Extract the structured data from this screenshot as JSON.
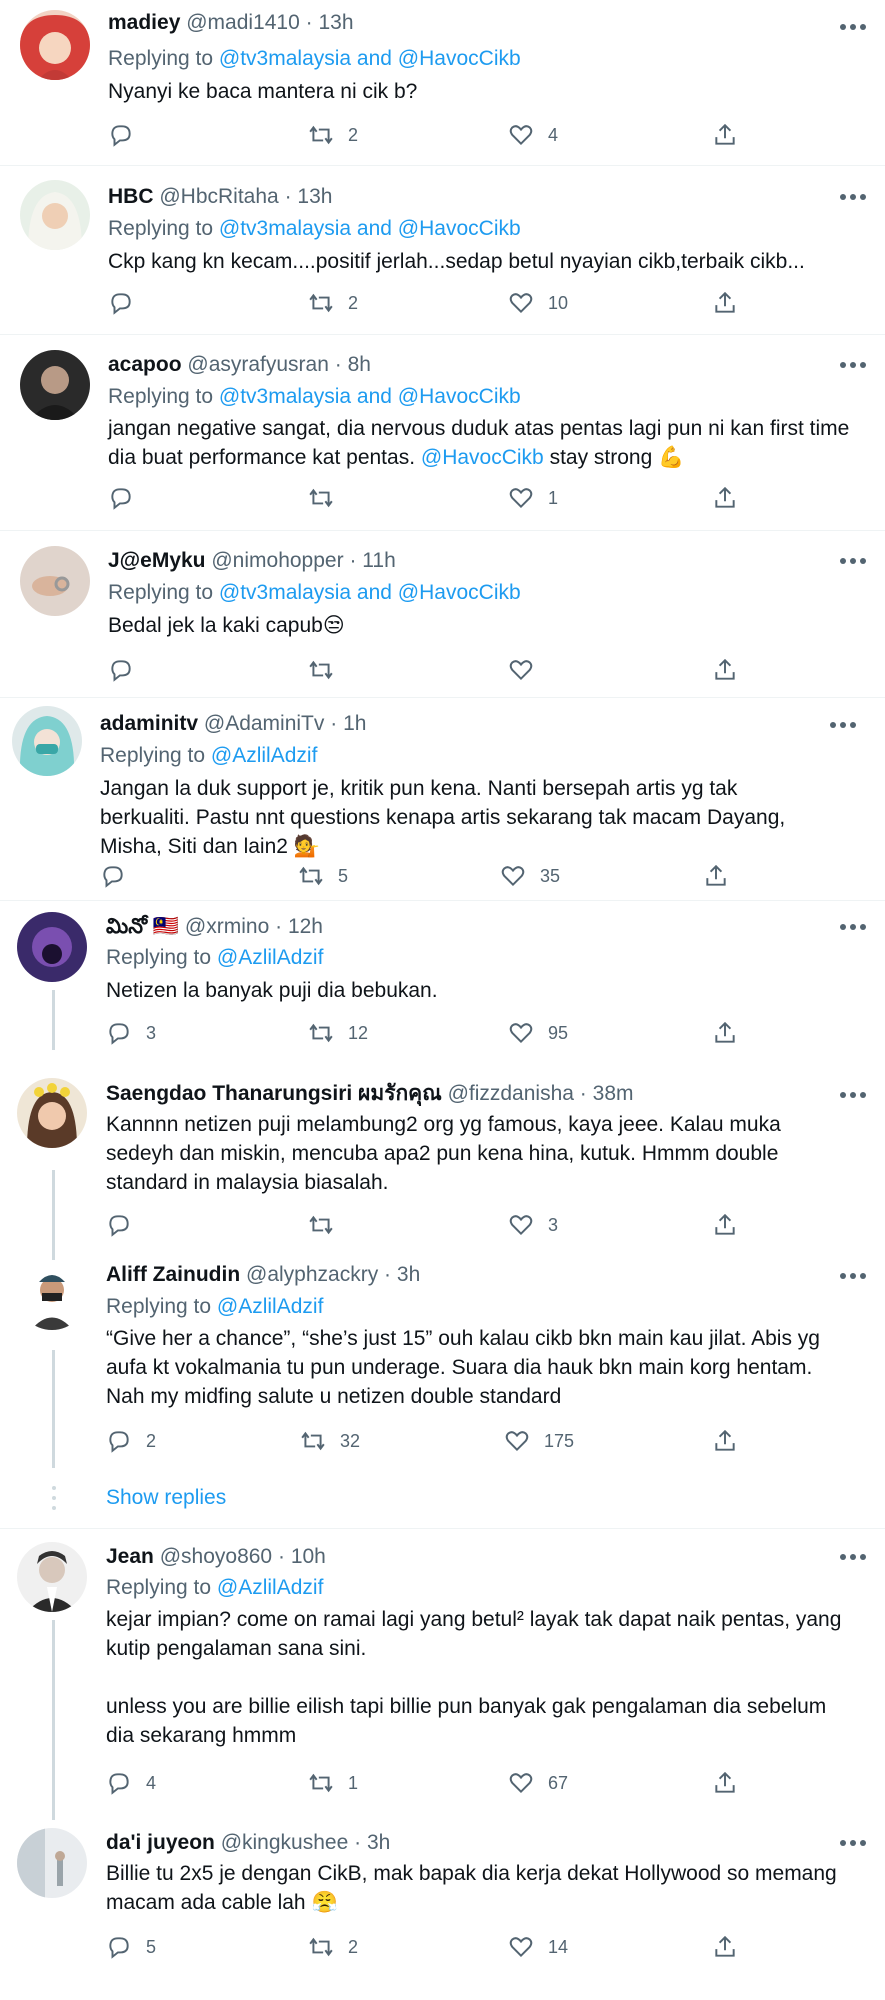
{
  "tweets": [
    {
      "name": "madiey",
      "handle": "@madi1410",
      "time": "13h",
      "replying_prefix": "Replying to",
      "replying_to": "@tv3malaysia and @HavocCikb",
      "text": "Nyanyi ke baca mantera ni cik b?",
      "replies": "",
      "retweets": "2",
      "likes": "4"
    },
    {
      "name": "HBC",
      "handle": "@HbcRitaha",
      "time": "13h",
      "replying_prefix": "Replying to",
      "replying_to": "@tv3malaysia and @HavocCikb",
      "text": "Ckp kang kn kecam....positif jerlah...sedap betul nyayian cikb,terbaik cikb...",
      "replies": "",
      "retweets": "2",
      "likes": "10"
    },
    {
      "name": "acapoo",
      "handle": "@asyrafyusran",
      "time": "8h",
      "replying_prefix": "Replying to",
      "replying_to": "@tv3malaysia and @HavocCikb",
      "text_a": "jangan negative sangat, dia nervous duduk atas pentas lagi pun ni kan first time dia buat performance kat pentas.",
      "mention": "@HavocCikb",
      "text_b": "stay strong",
      "emoji": "💪",
      "replies": "",
      "retweets": "",
      "likes": "1"
    },
    {
      "name": "J@eMyku",
      "handle": "@nimohopper",
      "time": "11h",
      "replying_prefix": "Replying to",
      "replying_to": "@tv3malaysia and @HavocCikb",
      "text": "Bedal jek la kaki capub",
      "emoji": "😒",
      "replies": "",
      "retweets": "",
      "likes": ""
    },
    {
      "name": "adaminitv",
      "handle": "@AdaminiTv",
      "time": "1h",
      "replying_prefix": "Replying to",
      "replying_to": "@AzlilAdzif",
      "text": "Jangan la duk support je, kritik pun kena. Nanti bersepah artis yg tak berkualiti. Pastu nnt questions kenapa artis sekarang tak macam Dayang, Misha, Siti dan lain2",
      "emoji": "💁",
      "replies": "",
      "retweets": "5",
      "likes": "35"
    },
    {
      "name": "మినో",
      "flag": "🇲🇾",
      "handle": "@xrmino",
      "time": "12h",
      "replying_prefix": "Replying to",
      "replying_to": "@AzlilAdzif",
      "text": "Netizen la banyak puji dia bebukan.",
      "replies": "3",
      "retweets": "12",
      "likes": "95"
    },
    {
      "name": "Saengdao Thanarungsiri ผมรักคุณ",
      "handle": "@fizzdanisha",
      "time": "38m",
      "replying_prefix": "",
      "replying_to": "",
      "text": "Kannnn netizen puji melambung2 org yg famous, kaya jeee. Kalau muka sedeyh dan miskin, mencuba apa2 pun kena hina, kutuk. Hmmm double standard in malaysia biasalah.",
      "replies": "",
      "retweets": "",
      "likes": "3"
    },
    {
      "name": "Aliff Zainudin",
      "handle": "@alyphzackry",
      "time": "3h",
      "replying_prefix": "Replying to",
      "replying_to": "@AzlilAdzif",
      "text": "“Give her a chance”, “she’s just 15” ouh kalau cikb bkn main kau jilat. Abis yg aufa kt vokalmania tu pun underage. Suara dia hauk bkn main korg hentam. Nah my midfing salute u netizen double standard",
      "replies": "2",
      "retweets": "32",
      "likes": "175"
    },
    {
      "name": "Jean",
      "handle": "@shoyo860",
      "time": "10h",
      "replying_prefix": "Replying to",
      "replying_to": "@AzlilAdzif",
      "text": "kejar impian? come on ramai lagi yang betul² layak tak dapat naik pentas, yang kutip pengalaman sana sini.",
      "text2": "unless you are billie eilish tapi billie pun banyak gak pengalaman dia sebelum dia sekarang hmmm",
      "replies": "4",
      "retweets": "1",
      "likes": "67"
    },
    {
      "name": "da'i juyeon",
      "handle": "@kingkushee",
      "time": "3h",
      "replying_prefix": "",
      "replying_to": "",
      "text": "Billie tu 2x5 je dengan CikB, mak bapak dia kerja dekat Hollywood so memang macam ada cable lah",
      "emoji": "😤",
      "replies": "5",
      "retweets": "2",
      "likes": "14"
    }
  ],
  "show_replies": "Show replies",
  "colors": {
    "link": "#1d9bf0",
    "secondary": "#536471",
    "text": "#0f1419",
    "divider": "#eff3f4",
    "thread": "#cfd9de"
  },
  "icons": [
    "reply-icon",
    "retweet-icon",
    "like-icon",
    "share-icon",
    "more-icon"
  ]
}
